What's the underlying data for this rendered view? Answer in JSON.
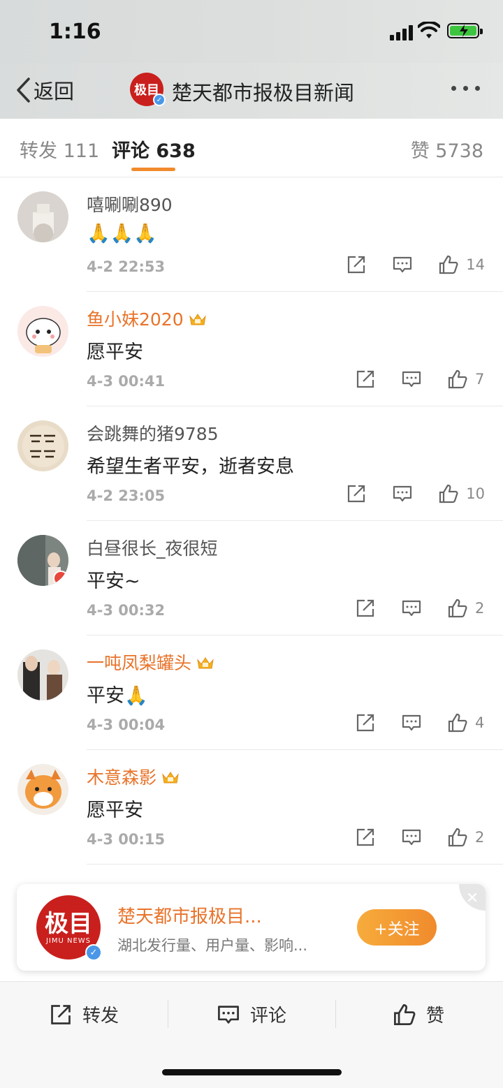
{
  "status": {
    "time": "1:16"
  },
  "nav": {
    "back_label": "返回",
    "avatar_text": "极目",
    "title": "楚天都市报极目新闻"
  },
  "tabs": [
    {
      "label": "转发 111"
    },
    {
      "label": "评论 638"
    },
    {
      "label": "赞 5738"
    }
  ],
  "comments": [
    {
      "user": "嘻唰唰890",
      "text": "🙏🙏🙏",
      "time": "4-2 22:53",
      "likes": "14",
      "vip": false
    },
    {
      "user": "鱼小妹2020",
      "text": "愿平安",
      "time": "4-3 00:41",
      "likes": "7",
      "vip": true
    },
    {
      "user": "会跳舞的猪9785",
      "text": "希望生者平安，逝者安息",
      "time": "4-2 23:05",
      "likes": "10",
      "vip": false
    },
    {
      "user": "白昼很长_夜很短",
      "text": "平安~",
      "time": "4-3 00:32",
      "likes": "2",
      "vip": false
    },
    {
      "user": "一吨凤梨罐头",
      "text": "平安🙏",
      "time": "4-3 00:04",
      "likes": "4",
      "vip": true
    },
    {
      "user": "木意森影",
      "text": "愿平安",
      "time": "4-3 00:15",
      "likes": "2",
      "vip": true
    }
  ],
  "follow_card": {
    "logo_text": "极目",
    "logo_sub": "JIMU NEWS",
    "title": "楚天都市报极目...",
    "subtitle": "湖北发行量、用户量、影响...",
    "follow_label": "+关注"
  },
  "bottom_bar": {
    "repost_label": "转发",
    "comment_label": "评论",
    "like_label": "赞"
  },
  "colors": {
    "accent": "#f08a2c",
    "vip_name": "#e8732a",
    "brand_red": "#c9201d",
    "verified_blue": "#4a97e8"
  }
}
